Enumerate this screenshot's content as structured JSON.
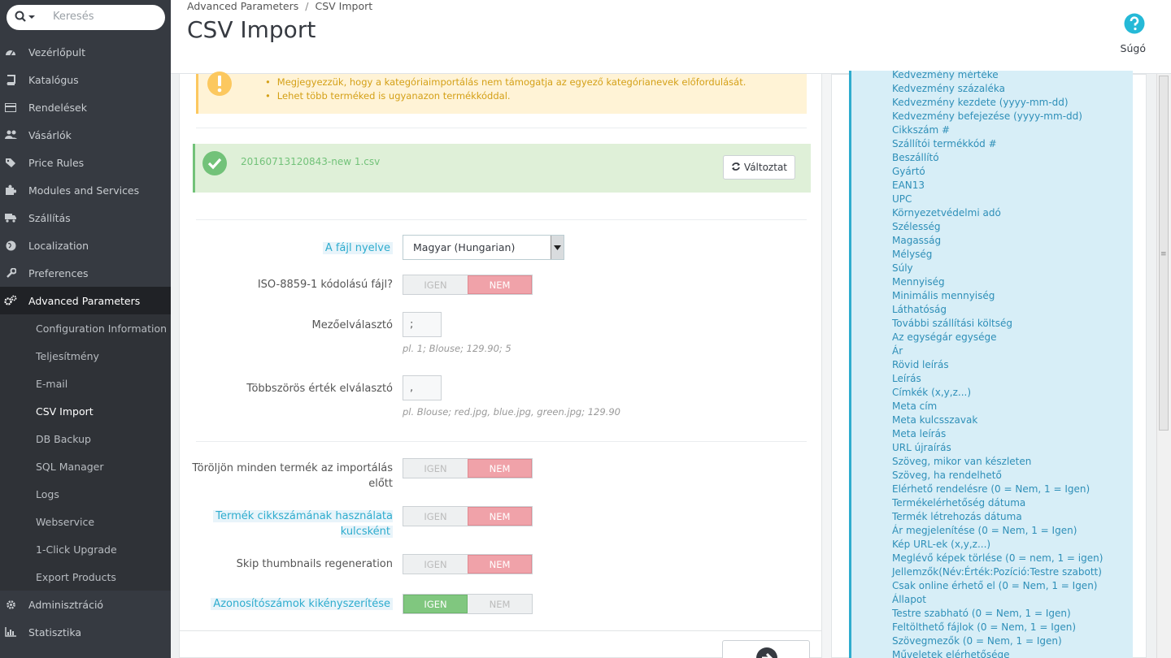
{
  "search": {
    "placeholder": "Keresés"
  },
  "sidebar": {
    "items": [
      {
        "label": "Vezérlőpult",
        "icon": "dashboard-icon"
      },
      {
        "label": "Katalógus",
        "icon": "book-icon"
      },
      {
        "label": "Rendelések",
        "icon": "credit-card-icon"
      },
      {
        "label": "Vásárlók",
        "icon": "users-icon"
      },
      {
        "label": "Price Rules",
        "icon": "tag-icon"
      },
      {
        "label": "Modules and Services",
        "icon": "puzzle-icon"
      },
      {
        "label": "Szállítás",
        "icon": "truck-icon"
      },
      {
        "label": "Localization",
        "icon": "globe-icon"
      },
      {
        "label": "Preferences",
        "icon": "wrench-icon"
      },
      {
        "label": "Advanced Parameters",
        "icon": "cogs-icon"
      }
    ],
    "sub_items": [
      "Configuration Information",
      "Teljesítmény",
      "E-mail",
      "CSV Import",
      "DB Backup",
      "SQL Manager",
      "Logs",
      "Webservice",
      "1-Click Upgrade",
      "Export Products"
    ],
    "bottom_items": [
      {
        "label": "Adminisztráció",
        "icon": "gear-icon"
      },
      {
        "label": "Statisztika",
        "icon": "bar-chart-icon"
      }
    ]
  },
  "header": {
    "breadcrumb": [
      "Advanced Parameters",
      "CSV Import"
    ],
    "title": "CSV Import",
    "help_label": "Súgó"
  },
  "warning": {
    "lines": [
      "Megjegyezzük, hogy a kategóriaimportálás nem támogatja az egyező kategórianevek előfordulását.",
      "Lehet több terméked is ugyanazon termékkóddal."
    ]
  },
  "file": {
    "name": "20160713120843-new 1.csv",
    "change_label": "Változtat"
  },
  "form": {
    "language_label": "A fájl nyelve",
    "language_value": "Magyar (Hungarian)",
    "iso_label": "ISO-8859-1 kódolású fájl?",
    "field_sep_label": "Mezőelválasztó",
    "field_sep_value": ";",
    "field_sep_help": "pl. 1; Blouse; 129.90; 5",
    "multi_sep_label": "Többszörös érték elválasztó",
    "multi_sep_value": ",",
    "multi_sep_help": "pl. Blouse; red.jpg, blue.jpg, green.jpg; 129.90",
    "delete_label": "Töröljön minden termék az importálás előtt",
    "sku_label": "Termék cikkszámának használata kulcsként",
    "skip_label": "Skip thumbnails regeneration",
    "force_label": "Azonosítószámok kikényszerítése",
    "yes": "IGEN",
    "no": "NEM",
    "iso_value": "NEM",
    "delete_value": "NEM",
    "sku_value": "NEM",
    "skip_value": "NEM",
    "force_value": "IGEN"
  },
  "available_fields": [
    "Kedvezmény mértéke",
    "Kedvezmény százaléka",
    "Kedvezmény kezdete (yyyy-mm-dd)",
    "Kedvezmény befejezése (yyyy-mm-dd)",
    "Cikkszám #",
    "Szállítói termékkód #",
    "Beszállító",
    "Gyártó",
    "EAN13",
    "UPC",
    "Környezetvédelmi adó",
    "Szélesség",
    "Magasság",
    "Mélység",
    "Súly",
    "Mennyiség",
    "Minimális mennyiség",
    "Láthatóság",
    "További szállítási költség",
    "Az egységár egysége",
    "Ár",
    "Rövid leírás",
    "Leírás",
    "Címkék (x,y,z...)",
    "Meta cím",
    "Meta kulcsszavak",
    "Meta leírás",
    "URL újraírás",
    "Szöveg, mikor van készleten",
    "Szöveg, ha rendelhető",
    "Elérhető rendelésre (0 = Nem, 1 = Igen)",
    "Termékelérhetőség dátuma",
    "Termék létrehozás dátuma",
    "Ár megjelenítése (0 = Nem, 1 = Igen)",
    "Kép URL-ek (x,y,z...)",
    "Meglévő képek törlése (0 = nem, 1 = igen)",
    "Jellemzők(Név:Érték:Pozíció:Testre szabott)",
    "Csak online érhető el (0 = Nem, 1 = Igen)",
    "Állapot",
    "Testre szabható (0 = Nem, 1 = Igen)",
    "Feltölthető fájlok (0 = Nem, 1 = Igen)",
    "Szövegmezők (0 = Nem, 1 = Igen)",
    "Műveletek elérhetősége"
  ]
}
